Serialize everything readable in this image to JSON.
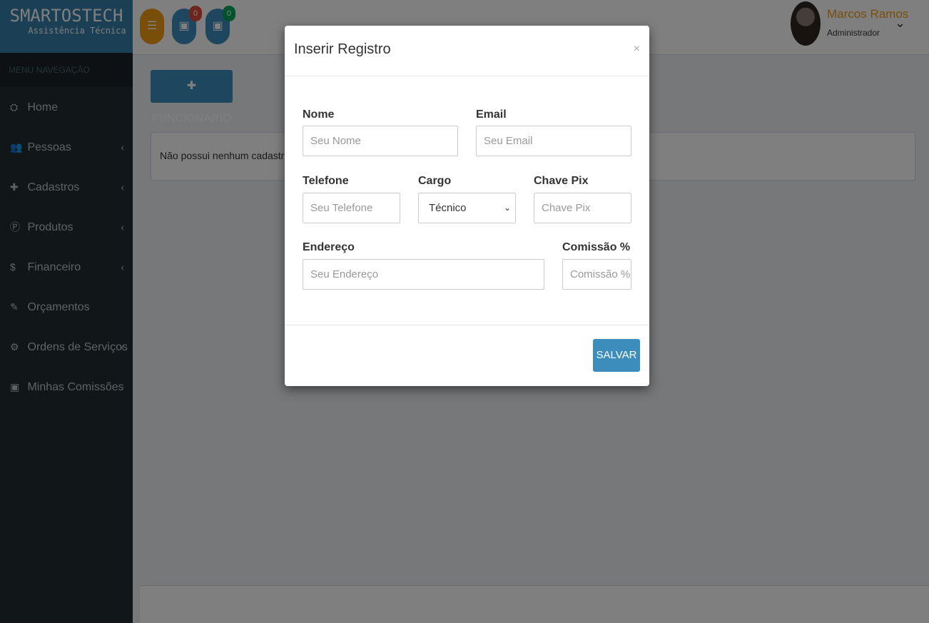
{
  "brand": {
    "name": "SMARTOSTECH",
    "subtitle": "Assistência Técnica"
  },
  "sidebar": {
    "header": "MENU NAVEGAÇÃO",
    "items": [
      {
        "label": "Home",
        "icon": "dashboard-icon",
        "glyph": "⛭",
        "has_submenu": false
      },
      {
        "label": "Pessoas",
        "icon": "users-icon",
        "glyph": "👥",
        "has_submenu": true
      },
      {
        "label": "Cadastros",
        "icon": "plus-icon",
        "glyph": "✚",
        "has_submenu": true
      },
      {
        "label": "Produtos",
        "icon": "product-icon",
        "glyph": "Ⓟ",
        "has_submenu": true
      },
      {
        "label": "Financeiro",
        "icon": "dollar-icon",
        "glyph": "$",
        "has_submenu": true
      },
      {
        "label": "Orçamentos",
        "icon": "pencil-icon",
        "glyph": "✎",
        "has_submenu": false
      },
      {
        "label": "Ordens de Serviços",
        "icon": "gear-icon",
        "glyph": "⚙",
        "has_submenu": true
      },
      {
        "label": "Minhas Comissões",
        "icon": "money-icon",
        "glyph": "▣",
        "has_submenu": false
      }
    ]
  },
  "header": {
    "menu_toggle_color": "#f39c12",
    "notifications": [
      {
        "icon": "money-icon",
        "count": "0",
        "badge_color": "#dd4b39"
      },
      {
        "icon": "money-icon",
        "count": "0",
        "badge_color": "#00a65a"
      }
    ],
    "user": {
      "name": "Marcos Ramos",
      "role": "Administrador"
    }
  },
  "content": {
    "add_button": "FUNCIONÁRIO",
    "empty_message": "Não possui nenhum cadastro!"
  },
  "modal": {
    "title": "Inserir Registro",
    "close": "×",
    "fields": {
      "nome": {
        "label": "Nome",
        "placeholder": "Seu Nome"
      },
      "email": {
        "label": "Email",
        "placeholder": "Seu Email"
      },
      "telefone": {
        "label": "Telefone",
        "placeholder": "Seu Telefone"
      },
      "cargo": {
        "label": "Cargo",
        "value": "Técnico"
      },
      "pix": {
        "label": "Chave Pix",
        "placeholder": "Chave Pix"
      },
      "endereco": {
        "label": "Endereço",
        "placeholder": "Seu Endereço"
      },
      "comissao": {
        "label": "Comissão %",
        "placeholder": "Comissão %"
      }
    },
    "save_button": "SALVAR"
  },
  "colors": {
    "primary": "#3c8dbc",
    "sidebar": "#222d32",
    "accent": "#f39c12"
  }
}
